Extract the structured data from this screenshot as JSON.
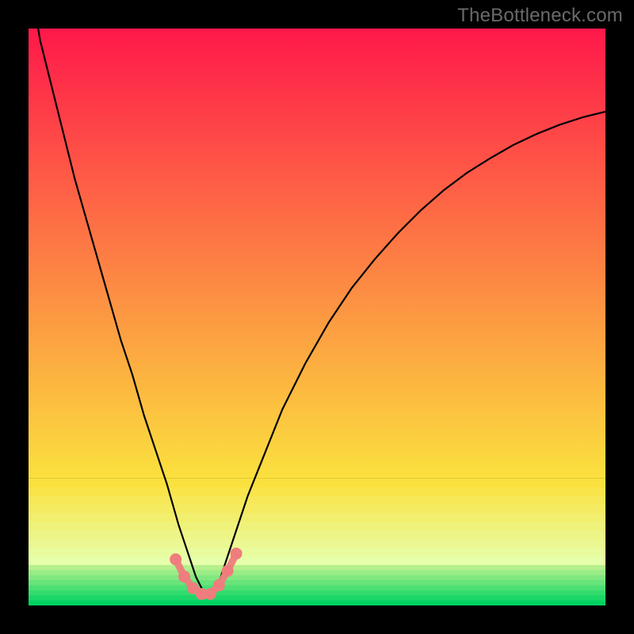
{
  "watermark": {
    "text": "TheBottleneck.com"
  },
  "colors": {
    "background_black": "#000000",
    "gradient_top": "#ff184a",
    "gradient_mid": "#fbe13e",
    "gradient_bottom": "#00d361",
    "curve": "#000000",
    "marker_fill": "#ef7d7d",
    "marker_stroke": "#d85a5a"
  },
  "chart_data": {
    "type": "line",
    "title": "",
    "xlabel": "",
    "ylabel": "",
    "xlim": [
      0,
      100
    ],
    "ylim": [
      0,
      100
    ],
    "grid": false,
    "legend": false,
    "series": [
      {
        "name": "bottleneck-curve",
        "x": [
          0,
          2,
          4,
          6,
          8,
          10,
          12,
          14,
          16,
          18,
          20,
          22,
          24,
          26,
          27,
          28,
          29,
          30,
          31,
          32,
          33,
          34,
          36,
          38,
          40,
          44,
          48,
          52,
          56,
          60,
          64,
          68,
          72,
          76,
          80,
          84,
          88,
          92,
          96,
          100
        ],
        "values": [
          110,
          98,
          90,
          82,
          74,
          67,
          60,
          53,
          46,
          40,
          33,
          27,
          21,
          14,
          11,
          8,
          5,
          3,
          2,
          2,
          4,
          7,
          13,
          19,
          24,
          34,
          42,
          49,
          55,
          60,
          64.5,
          68.5,
          72,
          75,
          77.5,
          79.8,
          81.7,
          83.3,
          84.6,
          85.6
        ]
      }
    ],
    "markers": {
      "name": "threshold-markers",
      "x": [
        25.5,
        27.0,
        28.5,
        30.0,
        31.5,
        33.0,
        34.5,
        36.0
      ],
      "values": [
        8.0,
        5.0,
        3.0,
        2.0,
        2.0,
        3.5,
        6.0,
        9.0
      ]
    },
    "gradient_bands": [
      {
        "from_pct": 0,
        "to_pct": 78,
        "type": "smooth",
        "from_color": "#ff184a",
        "to_color": "#fbe13e"
      },
      {
        "from_pct": 78,
        "to_pct": 93,
        "type": "banded_yellow"
      },
      {
        "from_pct": 93,
        "to_pct": 100,
        "type": "banded_green"
      }
    ]
  }
}
